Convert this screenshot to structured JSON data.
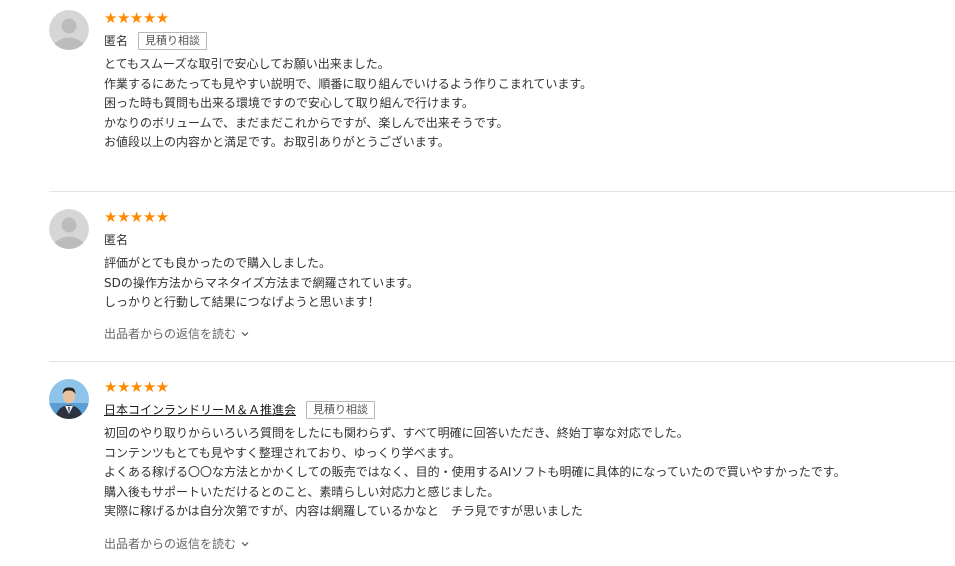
{
  "reviews": [
    {
      "stars": "★★★★★",
      "name": "匿名",
      "tag": "見積り相談",
      "lines": [
        "とてもスムーズな取引で安心してお願い出来ました。",
        "作業するにあたっても見やすい説明で、順番に取り組んでいけるよう作りこまれています。",
        "困った時も質問も出来る環境ですので安心して取り組んで行けます。",
        "かなりのボリュームで、まだまだこれからですが、楽しんで出来そうです。",
        "お値段以上の内容かと満足です。お取引ありがとうございます。"
      ]
    },
    {
      "stars": "★★★★★",
      "name": "匿名",
      "lines": [
        "評価がとても良かったので購入しました。",
        "SDの操作方法からマネタイズ方法まで網羅されています。",
        "しっかりと行動して結果につなげようと思います！"
      ],
      "reply_link": "出品者からの返信を読む"
    },
    {
      "stars": "★★★★★",
      "name": "日本コインランドリーＭ＆Ａ推進会",
      "tag": "見積り相談",
      "lines": [
        "初回のやり取りからいろいろ質問をしたにも関わらず、すべて明確に回答いただき、終始丁寧な対応でした。",
        "コンテンツもとても見やすく整理されており、ゆっくり学べます。",
        "よくある稼げる〇〇な方法とかかくしての販売ではなく、目的・使用するAIソフトも明確に具体的になっていたので買いやすかったです。",
        "購入後もサポートいただけるとのこと、素晴らしい対応力と感じました。",
        "実際に稼げるかは自分次第ですが、内容は網羅しているかなと　チラ見ですが思いました"
      ],
      "reply_link": "出品者からの返信を読む"
    }
  ],
  "colors": {
    "star": "#ff8a00",
    "text": "#333333",
    "divider": "#e5e5e5"
  },
  "icons": {
    "anonymous_avatar": "default-user-avatar-icon",
    "chevron": "chevron-down-icon"
  }
}
